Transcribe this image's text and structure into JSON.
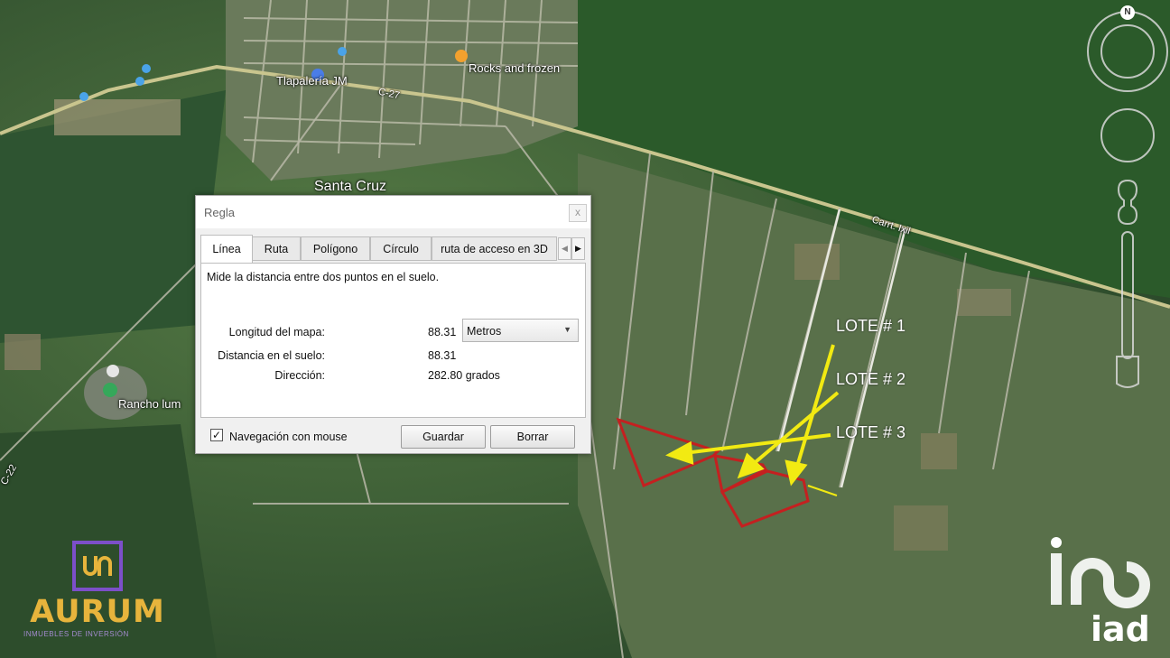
{
  "map": {
    "labels": {
      "santa_cruz": "Santa Cruz",
      "tlapaleria": "Tlapalería JM",
      "rocks": "Rocks and frozen",
      "rancho": "Rancho lum",
      "road_c27": "C-27",
      "road_carr": "Carrt. Ixil",
      "road_c22": "C-22"
    },
    "lotes": [
      "LOTE # 1",
      "LOTE # 2",
      "LOTE # 3"
    ],
    "colors": {
      "arrow": "#f2ea12",
      "lot_outline": "#c42020",
      "ruler_line": "#f2ea12"
    }
  },
  "dialog": {
    "title": "Regla",
    "close": "x",
    "tabs": [
      "Línea",
      "Ruta",
      "Polígono",
      "Círculo",
      "ruta de acceso en 3D"
    ],
    "active_tab": "Línea",
    "description": "Mide la distancia entre dos puntos en el suelo.",
    "map_length_label": "Longitud del mapa:",
    "map_length_value": "88.31",
    "unit": "Metros",
    "ground_distance_label": "Distancia en el suelo:",
    "ground_distance_value": "88.31",
    "direction_label": "Dirección:",
    "direction_value": "282.80 grados",
    "mouse_nav_label": "Navegación con mouse",
    "mouse_nav_checked": true,
    "save": "Guardar",
    "clear": "Borrar"
  },
  "brand": {
    "aurum": "AURUM",
    "aurum_tagline": "INMUEBLES DE INVERSIÓN",
    "iad": "iad"
  },
  "nav": {
    "north": "N"
  }
}
